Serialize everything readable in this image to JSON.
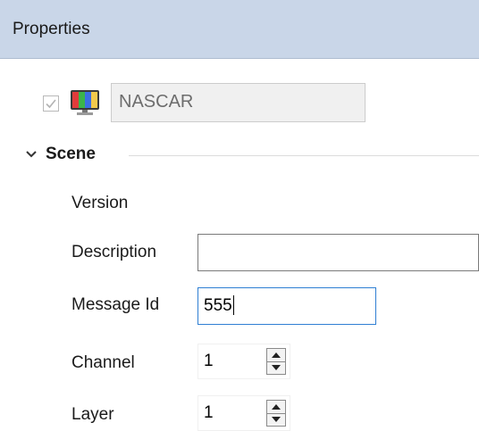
{
  "panel": {
    "title": "Properties"
  },
  "object": {
    "name": "NASCAR",
    "enabled": true,
    "icon": "monitor-icon"
  },
  "section": {
    "label": "Scene",
    "expanded": true,
    "icon": "chevron-down-icon"
  },
  "fields": {
    "version": {
      "label": "Version",
      "value": ""
    },
    "description": {
      "label": "Description",
      "value": ""
    },
    "message_id": {
      "label": "Message Id",
      "value": "555"
    },
    "channel": {
      "label": "Channel",
      "value": "1"
    },
    "layer": {
      "label": "Layer",
      "value": "1"
    }
  },
  "colors": {
    "titlebar": "#c9d6e8",
    "focus_border": "#2f7fd3"
  }
}
